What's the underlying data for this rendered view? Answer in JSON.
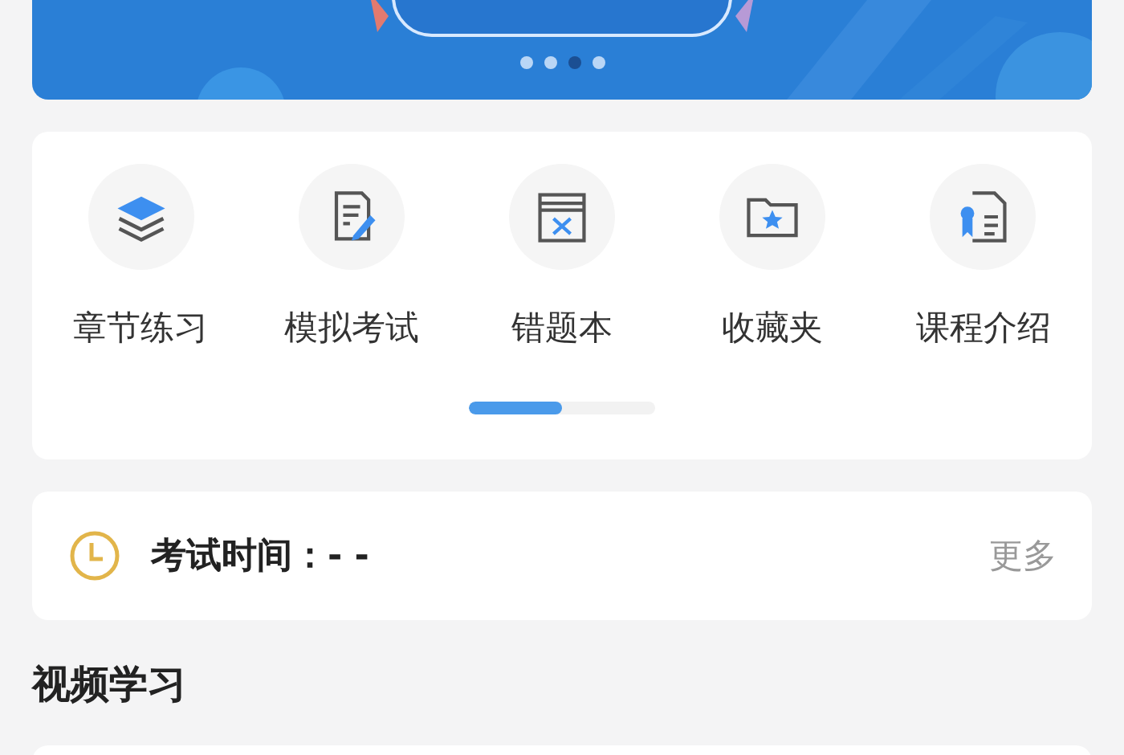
{
  "banner": {
    "kind": "picture",
    "dots": [
      {
        "selected": false
      },
      {
        "selected": false
      },
      {
        "selected": true
      },
      {
        "selected": false
      }
    ]
  },
  "shortcuts": {
    "items": [
      {
        "kind": "layers",
        "label": "章节练习"
      },
      {
        "kind": "exam",
        "label": "模拟考试"
      },
      {
        "kind": "wrong",
        "label": "错题本"
      },
      {
        "kind": "favorite",
        "label": "收藏夹"
      },
      {
        "kind": "course",
        "label": "课程介绍"
      }
    ],
    "scroll": {
      "level": 0.5
    }
  },
  "exam_time": {
    "label": "考试时间：- -",
    "more": "更多"
  },
  "section": {
    "title": "视频学习"
  }
}
